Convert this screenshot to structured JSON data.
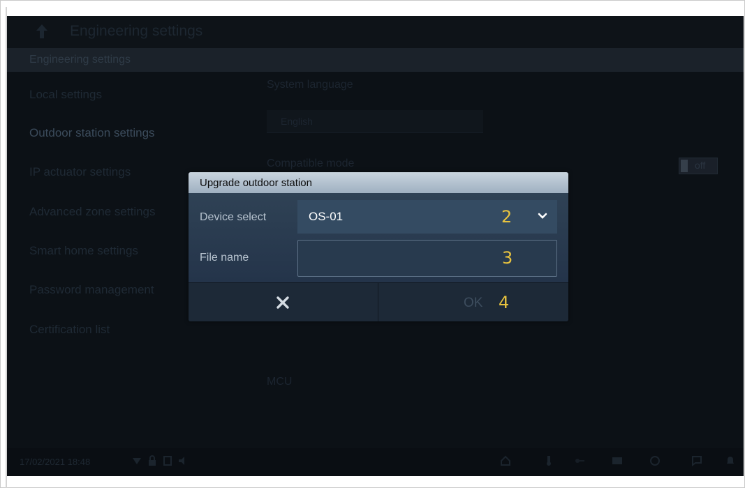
{
  "top_bar": {
    "title": "Engineering settings",
    "back_icon": "up-arrow-icon"
  },
  "section": {
    "title": "Engineering settings"
  },
  "menu": {
    "items": [
      {
        "label": "Local settings"
      },
      {
        "label": "Outdoor station settings"
      },
      {
        "label": "IP actuator settings"
      },
      {
        "label": "Advanced zone settings"
      },
      {
        "label": "Smart home settings"
      },
      {
        "label": "Password management"
      },
      {
        "label": "Certification list"
      }
    ]
  },
  "settings": {
    "system_language_label": "System language",
    "system_language_value": "English",
    "compatible_mode_label": "Compatible mode",
    "compatible_mode_state": "off",
    "mcu_label": "MCU"
  },
  "status_bar": {
    "datetime": "17/02/2021  18:48"
  },
  "dialog": {
    "title": "Upgrade outdoor station",
    "device_select_label": "Device select",
    "device_select_value": "OS-01",
    "file_name_label": "File name",
    "file_name_value": "",
    "ok_label": "OK",
    "annotations": {
      "select": "2",
      "file": "3",
      "ok": "4"
    }
  },
  "colors": {
    "accent_annotation": "#e8c33f",
    "dialog_header": "#b4c2d0",
    "dialog_body": "#2a3b4e"
  }
}
